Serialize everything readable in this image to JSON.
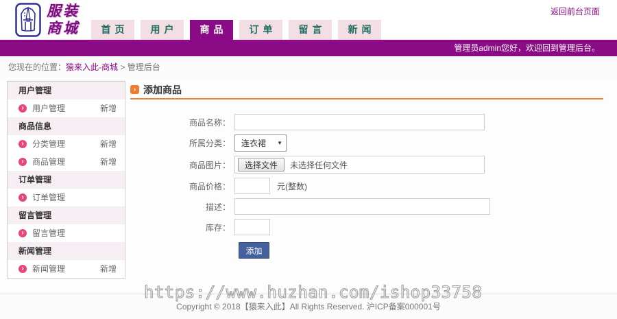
{
  "header": {
    "logo_line1": "服装",
    "logo_line2": "商城",
    "return_link": "返回前台页面",
    "tabs": [
      {
        "label": "首页",
        "active": false
      },
      {
        "label": "用户",
        "active": false
      },
      {
        "label": "商品",
        "active": true
      },
      {
        "label": "订单",
        "active": false
      },
      {
        "label": "留言",
        "active": false
      },
      {
        "label": "新闻",
        "active": false
      }
    ],
    "admin_bar": "管理员admin您好，欢迎回到管理后台。"
  },
  "breadcrumb": {
    "prefix": "您现在的位置：",
    "link": "猿来入此-商城",
    "separator": ">",
    "current": "管理后台"
  },
  "sidebar": {
    "sections": [
      {
        "title": "用户管理",
        "items": [
          {
            "label": "用户管理",
            "add": "新增"
          }
        ]
      },
      {
        "title": "商品信息",
        "items": [
          {
            "label": "分类管理",
            "add": "新增"
          },
          {
            "label": "商品管理",
            "add": "新增"
          }
        ]
      },
      {
        "title": "订单管理",
        "items": [
          {
            "label": "订单管理",
            "add": ""
          }
        ]
      },
      {
        "title": "留言管理",
        "items": [
          {
            "label": "留言管理",
            "add": ""
          }
        ]
      },
      {
        "title": "新闻管理",
        "items": [
          {
            "label": "新闻管理",
            "add": "新增"
          }
        ]
      }
    ]
  },
  "main": {
    "title": "添加商品",
    "form": {
      "name_label": "商品名称：",
      "category_label": "所属分类：",
      "category_value": "连衣裙",
      "dropdown_arrow": "▼",
      "image_label": "商品图片：",
      "file_button": "选择文件",
      "file_status": "未选择任何文件",
      "price_label": "商品价格：",
      "price_suffix": "元(整数)",
      "desc_label": "描述：",
      "stock_label": "库存：",
      "submit_label": "添加"
    }
  },
  "watermark": "https://www.huzhan.com/ishop33758",
  "footer": "Copyright © 2018【猿来入此】All Rights Reserved. 沪ICP备案000001号",
  "colors": {
    "primary_purple": "#8b0a86",
    "tab_bg": "#f2dee3",
    "tab_text": "#1f6b5e",
    "accent_orange": "#ef7d31",
    "bullet_pink": "#e8457e",
    "submit_blue": "#44619d"
  }
}
